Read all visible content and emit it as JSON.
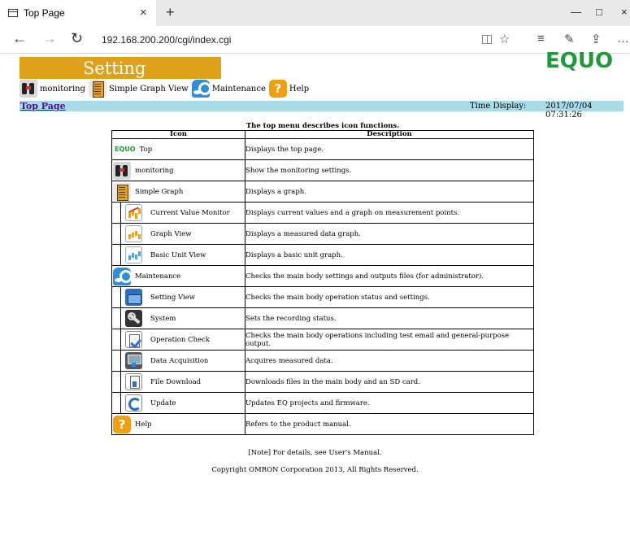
{
  "browser": {
    "tab_title": "Top Page",
    "tab_close": "×",
    "new_tab": "+",
    "win_min": "—",
    "win_max": "□",
    "win_close": "×",
    "back": "←",
    "forward": "→",
    "refresh": "↻",
    "url": "192.168.200.200/cgi/index.cgi",
    "favorite": "☆",
    "hub": "≡",
    "notes": "✎",
    "share": "⇪",
    "more": "…"
  },
  "header": {
    "title": "Setting",
    "logo": "EQUO",
    "brand_color": "#1e9a3c",
    "accent_color": "#e0a11a"
  },
  "menu": [
    {
      "label": "monitoring",
      "icon": "binoculars-icon"
    },
    {
      "label": "Simple Graph View",
      "icon": "graph-book-icon"
    },
    {
      "label": "Maintenance",
      "icon": "maintenance-icon"
    },
    {
      "label": "Help",
      "icon": "help-icon"
    }
  ],
  "status": {
    "top_link": "Top Page",
    "time_label": "Time Display:",
    "time_value": "2017/07/04 07:31:26",
    "bar_color": "#a7dbe8"
  },
  "table": {
    "caption": "The top menu describes icon functions.",
    "headers": [
      "Icon",
      "Description"
    ],
    "rows": [
      {
        "name": "Top",
        "icon": "equo-logo-icon",
        "description": "Displays the top page."
      },
      {
        "name": "monitoring",
        "icon": "binoculars-icon",
        "description": "Show the monitoring settings."
      },
      {
        "name": "Simple Graph",
        "icon": "graph-book-icon",
        "description": "Displays a graph."
      },
      {
        "name": "Current Value Monitor",
        "icon": "line-chart-icon",
        "description": "Displays current values and a graph on measurement points."
      },
      {
        "name": "Graph View",
        "icon": "bar-chart-icon",
        "description": "Displays a measured data graph."
      },
      {
        "name": "Basic Unit View",
        "icon": "basic-unit-chart-icon",
        "description": "Displays a basic unit graph."
      },
      {
        "name": "Maintenance",
        "icon": "maintenance-icon",
        "description": "Checks the main body settings and outputs files (for administrator)."
      },
      {
        "name": "Setting View",
        "icon": "toolbox-icon",
        "description": "Checks the main body operation status and settings."
      },
      {
        "name": "System",
        "icon": "wrench-icon",
        "description": "Sets the recording status."
      },
      {
        "name": "Operation Check",
        "icon": "checklist-icon",
        "description": "Checks the main body operations including test email and general-purpose output."
      },
      {
        "name": "Data Acquisition",
        "icon": "data-acquisition-icon",
        "description": "Acquires measured data."
      },
      {
        "name": "File Download",
        "icon": "file-download-icon",
        "description": "Downloads files in the main body and an SD card."
      },
      {
        "name": "Update",
        "icon": "update-icon",
        "description": "Updates EQ projects and firmware."
      },
      {
        "name": "Help",
        "icon": "help-icon",
        "description": "Refers to the product manual."
      }
    ],
    "equo_small": "EQUO",
    "help_glyph": "?"
  },
  "footer": {
    "note": "[Note] For details, see User's Manual.",
    "copyright": "Copyright OMRON Corporation 2013, All Rights Reserved."
  }
}
